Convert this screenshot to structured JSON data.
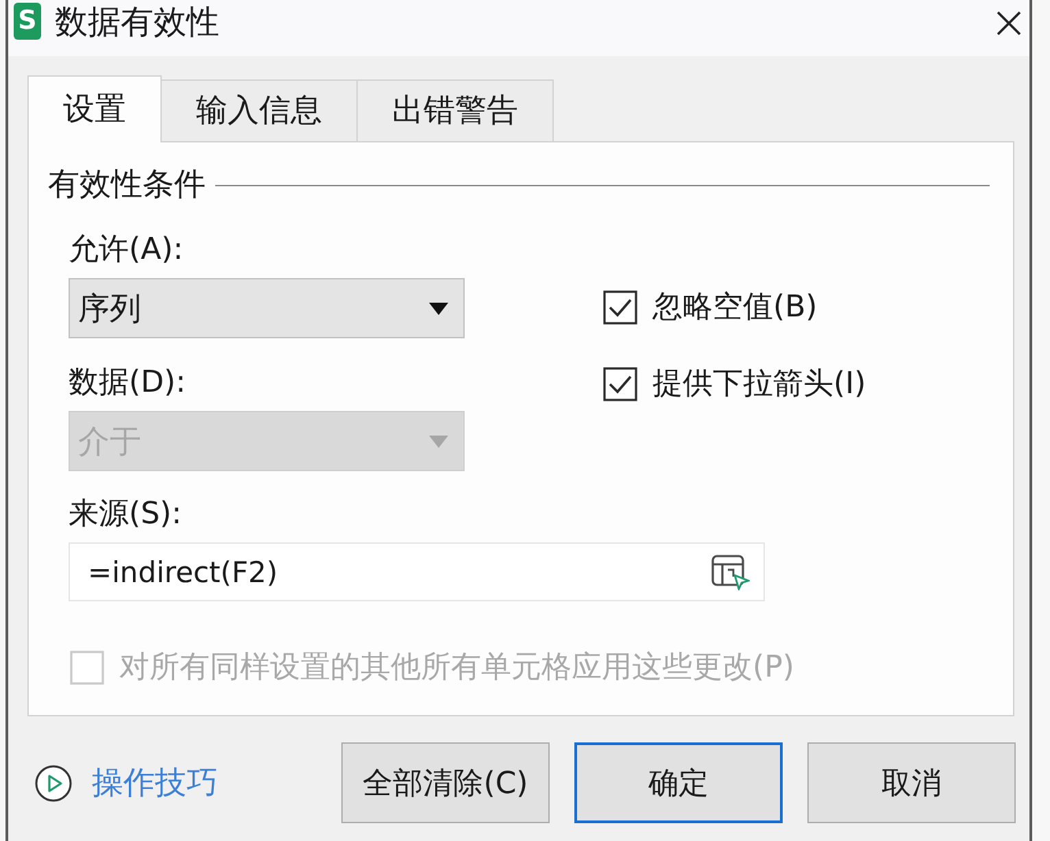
{
  "window": {
    "logo": "S",
    "title": "数据有效性"
  },
  "tabs": [
    {
      "label": "设置",
      "selected": true
    },
    {
      "label": "输入信息",
      "selected": false
    },
    {
      "label": "出错警告",
      "selected": false
    }
  ],
  "validation": {
    "group_title": "有效性条件",
    "fields": [
      {
        "label": "允许(A):",
        "value": "序列",
        "disabled": false
      },
      {
        "label": "数据(D):",
        "value": "介于",
        "disabled": true
      }
    ],
    "options": [
      {
        "label": "忽略空值(B)",
        "checked": true
      },
      {
        "label": "提供下拉箭头(I)",
        "checked": true
      }
    ],
    "source": {
      "label": "来源(S):",
      "value": "=indirect(F2)"
    },
    "apply_all": {
      "label": "对所有同样设置的其他所有单元格应用这些更改(P)",
      "checked": false,
      "disabled": true
    }
  },
  "footer": {
    "tips_link": "操作技巧",
    "buttons": [
      {
        "label": "全部清除(C)",
        "default": false
      },
      {
        "label": "确定",
        "default": true
      },
      {
        "label": "取消",
        "default": false
      }
    ]
  }
}
